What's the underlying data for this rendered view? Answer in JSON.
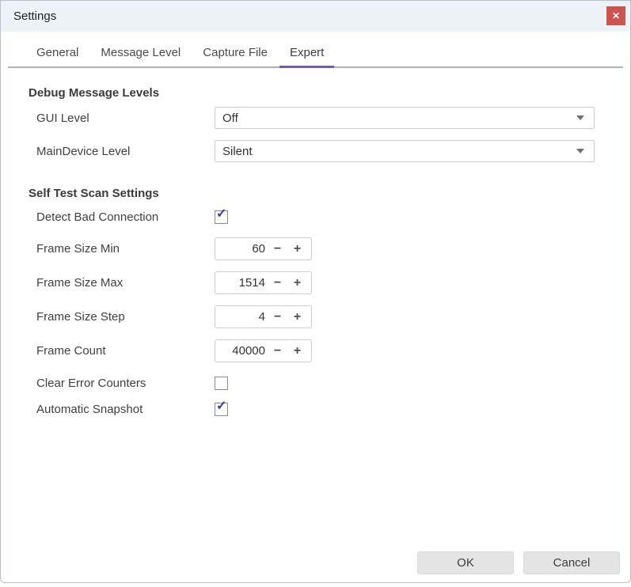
{
  "window": {
    "title": "Settings",
    "close_icon": "✕"
  },
  "tabs": [
    {
      "label": "General",
      "active": false
    },
    {
      "label": "Message Level",
      "active": false
    },
    {
      "label": "Capture File",
      "active": false
    },
    {
      "label": "Expert",
      "active": true
    }
  ],
  "debug_section": {
    "title": "Debug Message Levels",
    "gui_level": {
      "label": "GUI Level",
      "value": "Off"
    },
    "maindevice_level": {
      "label": "MainDevice Level",
      "value": "Silent"
    }
  },
  "selftest_section": {
    "title": "Self Test Scan Settings",
    "detect_bad_connection": {
      "label": "Detect Bad Connection",
      "checked": true,
      "check_glyph": "✓"
    },
    "frame_size_min": {
      "label": "Frame Size Min",
      "value": "60"
    },
    "frame_size_max": {
      "label": "Frame Size Max",
      "value": "1514"
    },
    "frame_size_step": {
      "label": "Frame Size Step",
      "value": "4"
    },
    "frame_count": {
      "label": "Frame Count",
      "value": "40000"
    },
    "clear_error_counters": {
      "label": "Clear Error Counters",
      "checked": false,
      "check_glyph": ""
    },
    "automatic_snapshot": {
      "label": "Automatic Snapshot",
      "checked": true,
      "check_glyph": "✓"
    }
  },
  "stepper": {
    "minus": "−",
    "plus": "+"
  },
  "footer": {
    "ok": "OK",
    "cancel": "Cancel"
  },
  "colors": {
    "accent_purple": "#7d57b5",
    "close_red": "#cd534f",
    "check_blue": "#2e3f94",
    "titlebar_bg": "#edf2f6",
    "tab_separator": "#b1b1b1"
  }
}
